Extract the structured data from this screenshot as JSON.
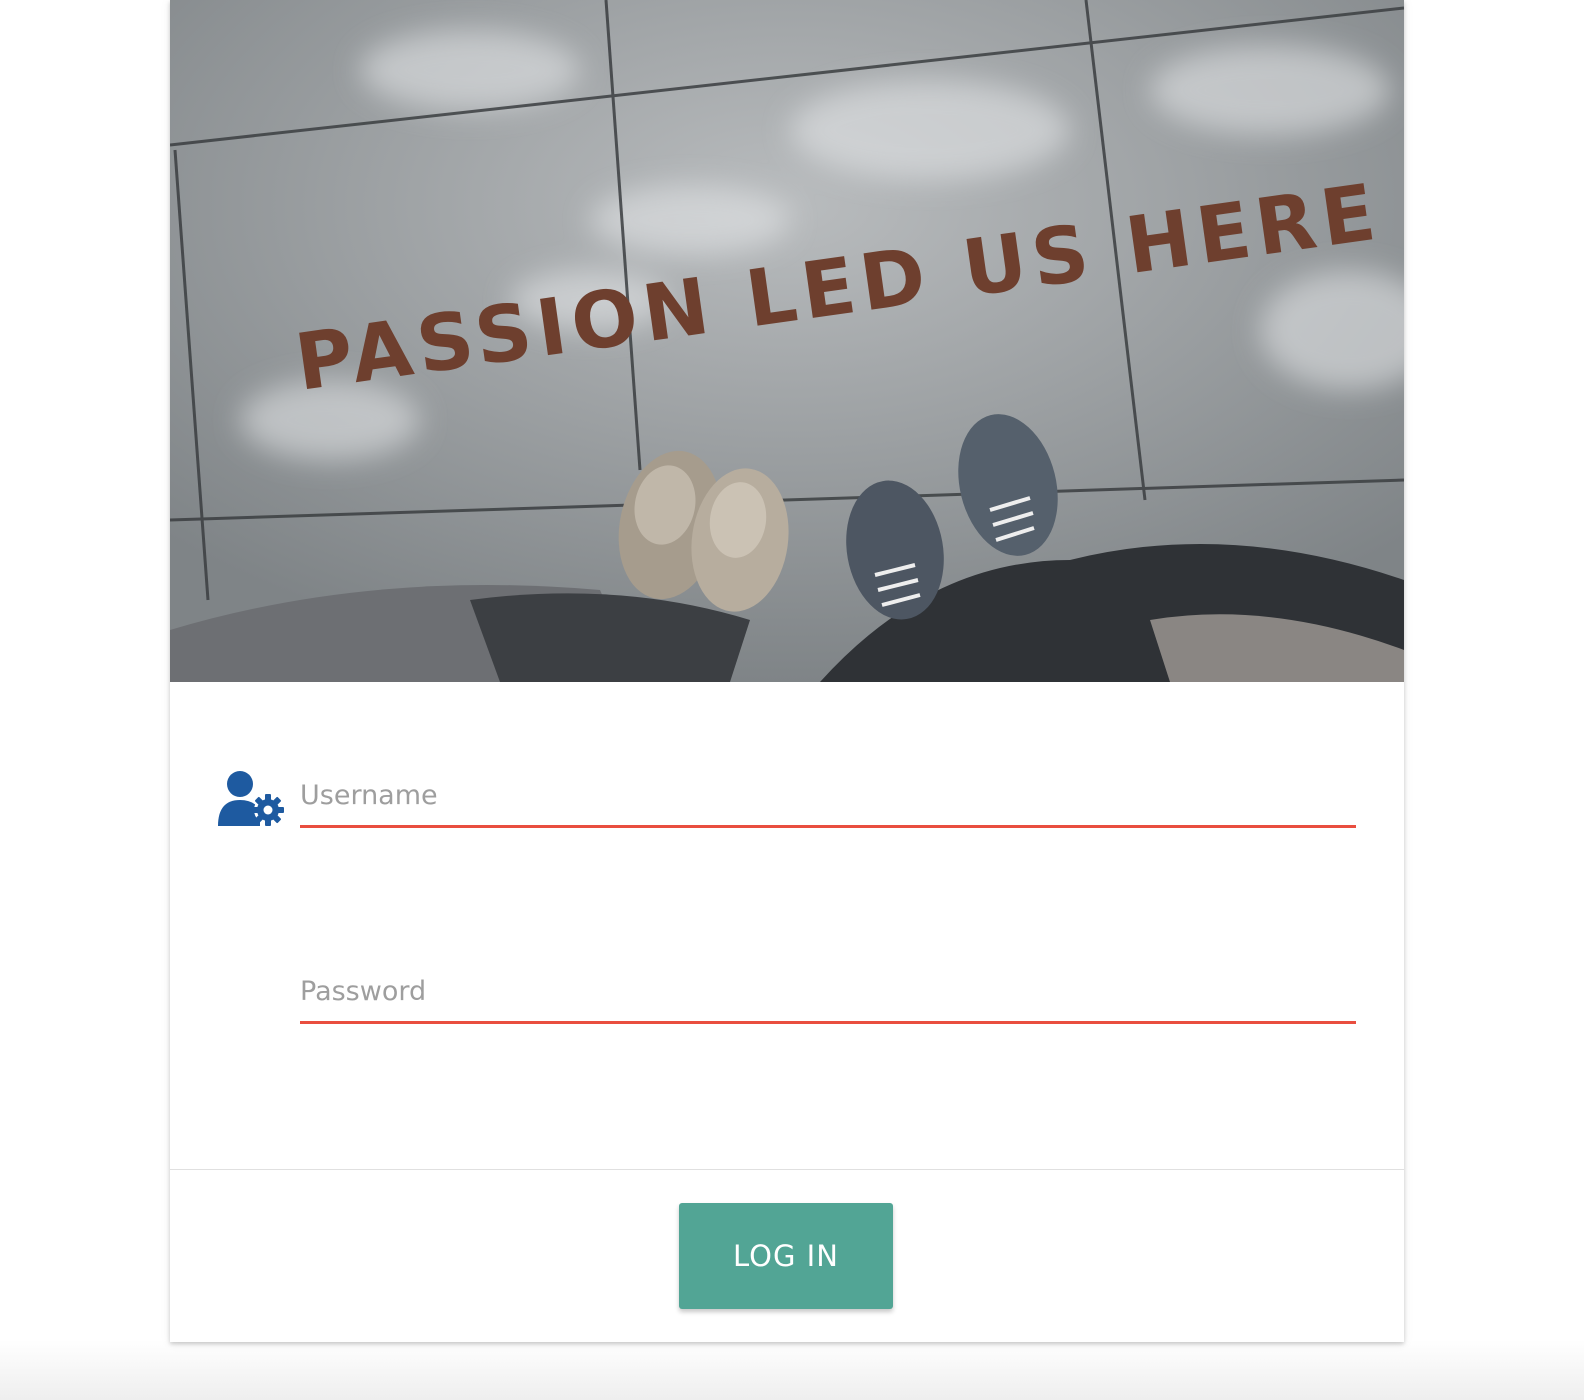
{
  "hero": {
    "image_icon": "photo-sidewalk-shoes",
    "caption": "PASSION LED US HERE"
  },
  "form": {
    "username": {
      "icon": "user-gear-icon",
      "placeholder": "Username",
      "value": ""
    },
    "password": {
      "placeholder": "Password",
      "value": ""
    },
    "underline_color": "#e94e3f"
  },
  "actions": {
    "login_label": "LOG IN",
    "login_color": "#52a595"
  },
  "colors": {
    "icon": "#1e5aa0",
    "background": "#ffffff"
  }
}
